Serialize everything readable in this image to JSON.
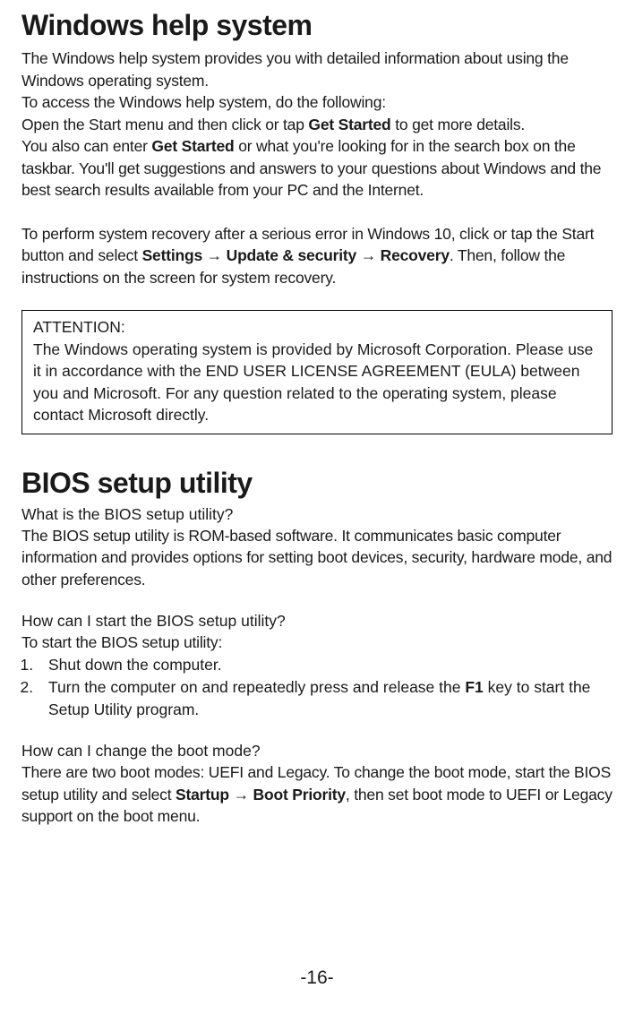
{
  "section1": {
    "heading": "Windows help system",
    "p1_a": "The Windows help system provides you with detailed information about using the Windows operating system.",
    "p1_b": "To access the Windows help system, do the following:",
    "p1_c_pre": "Open the Start menu and then click or tap ",
    "p1_c_bold": "Get Started",
    "p1_c_post": " to get more details.",
    "p1_d_pre": "You also can enter ",
    "p1_d_bold": "Get Started",
    "p1_d_post": " or what you're looking for in the search box on the taskbar. You'll get suggestions and answers to your questions about Windows and the best search results available from your PC and the Internet.",
    "p2_pre": "To perform system recovery after a serious error in Windows 10, click or tap the Start button and select ",
    "p2_b1": "Settings",
    "p2_arrow1": " → ",
    "p2_b2": "Update & security",
    "p2_arrow2": " → ",
    "p2_b3": "Recovery",
    "p2_post": ". Then, follow the instructions on the screen for system recovery.",
    "attention_label": "ATTENTION:",
    "attention_body": "The Windows operating system is provided by Microsoft Corporation. Please use it in accordance with the END USER LICENSE AGREEMENT (EULA) between you and Microsoft. For any question related to the operating system, please contact Microsoft directly."
  },
  "section2": {
    "heading": "BIOS setup utility",
    "sub1": "What is the BIOS setup utility?",
    "sub1_body": "The BIOS setup utility is ROM-based software. It communicates basic computer information and provides options for setting boot devices, security, hardware mode, and other preferences.",
    "sub2": "How can I start the BIOS setup utility?",
    "sub2_intro": "To start the BIOS setup utility:",
    "li1": "Shut down the computer.",
    "li2_pre": "Turn the computer on and repeatedly press and release the ",
    "li2_bold": "F1",
    "li2_post": " key to start the Setup Utility program.",
    "sub3": "How can I change the boot mode?",
    "sub3_pre": "There are two boot modes: UEFI and Legacy. To change the boot mode, start the BIOS setup utility and select ",
    "sub3_b1": "Startup",
    "sub3_arrow": " → ",
    "sub3_b2": "Boot Priority",
    "sub3_post": ", then set boot mode to UEFI or Legacy support on the boot menu."
  },
  "page_number": "-16-"
}
